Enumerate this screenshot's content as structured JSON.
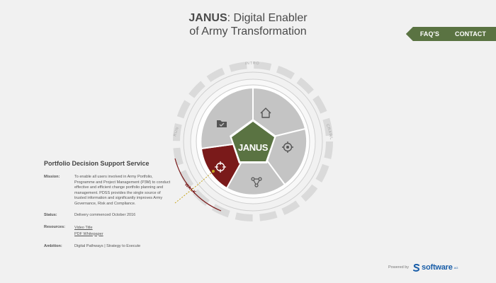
{
  "header": {
    "title_strong": "JANUS",
    "title_rest": ": Digital Enabler",
    "title_line2": "of Army Transformation"
  },
  "nav": {
    "faqs": "FAQ'S",
    "contact": "CONTACT"
  },
  "wheel": {
    "center_label": "JANUS",
    "ring_labels": {
      "top": "INTRO",
      "left": "RUN",
      "right": "CRAWL",
      "active": "WALK"
    },
    "segment_icons": {
      "home": "home-icon",
      "target": "target-icon",
      "share": "share-icon",
      "crosshair": "crosshair-icon",
      "folder": "folder-check-icon"
    },
    "colors": {
      "accent_green": "#5a7342",
      "active_red": "#7a1a1a",
      "segment_grey": "#c4c4c4"
    }
  },
  "info": {
    "title": "Portfolio Decision Support Service",
    "mission_label": "Mission:",
    "mission_text": "To enable all users involved in Army Portfolio, Programme and Project Management (P3M) to conduct effective and efficient change portfolio planning and management. PDSS provides the single source of trusted information and significantly improves Army Governance, Risk and Compliance.",
    "status_label": "Status:",
    "status_text": "Delivery commenced October 2016",
    "resources_label": "Resources:",
    "resources": [
      "Video Title",
      "PDF Whitepaper"
    ],
    "ambition_label": "Ambition:",
    "ambition_link1": "Digital Pathways",
    "ambition_sep": " | ",
    "ambition_link2": "Strategy to Execute"
  },
  "footer": {
    "powered_by": "Powered by",
    "brand": "software",
    "brand_tm": "AG"
  }
}
